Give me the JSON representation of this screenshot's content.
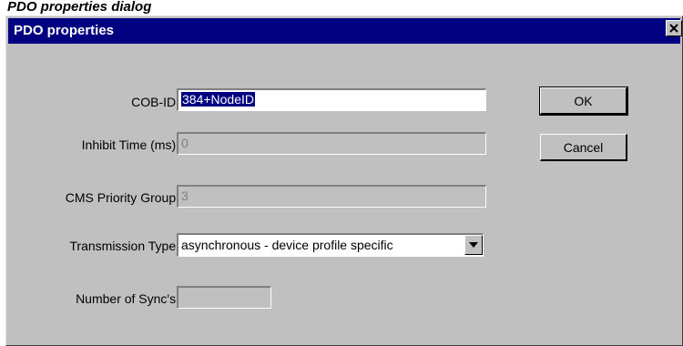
{
  "caption": "PDO properties dialog",
  "dialog": {
    "title": "PDO properties",
    "close_icon": "close-x-icon"
  },
  "fields": {
    "cob_id": {
      "label": "COB-ID:",
      "value": "384+NodeID"
    },
    "inhibit_time": {
      "label": "Inhibit Time (ms):",
      "value": "0"
    },
    "cms_priority": {
      "label": "CMS Priority Group:",
      "value": "3"
    },
    "transmission_type": {
      "label": "Transmission Type:",
      "value": "asynchronous - device profile specific"
    },
    "num_syncs": {
      "label": "Number of Sync's:",
      "value": ""
    }
  },
  "buttons": {
    "ok": "OK",
    "cancel": "Cancel"
  },
  "colors": {
    "face": "#c0c0c0",
    "titlebar": "#000080",
    "selection": "#000080"
  }
}
